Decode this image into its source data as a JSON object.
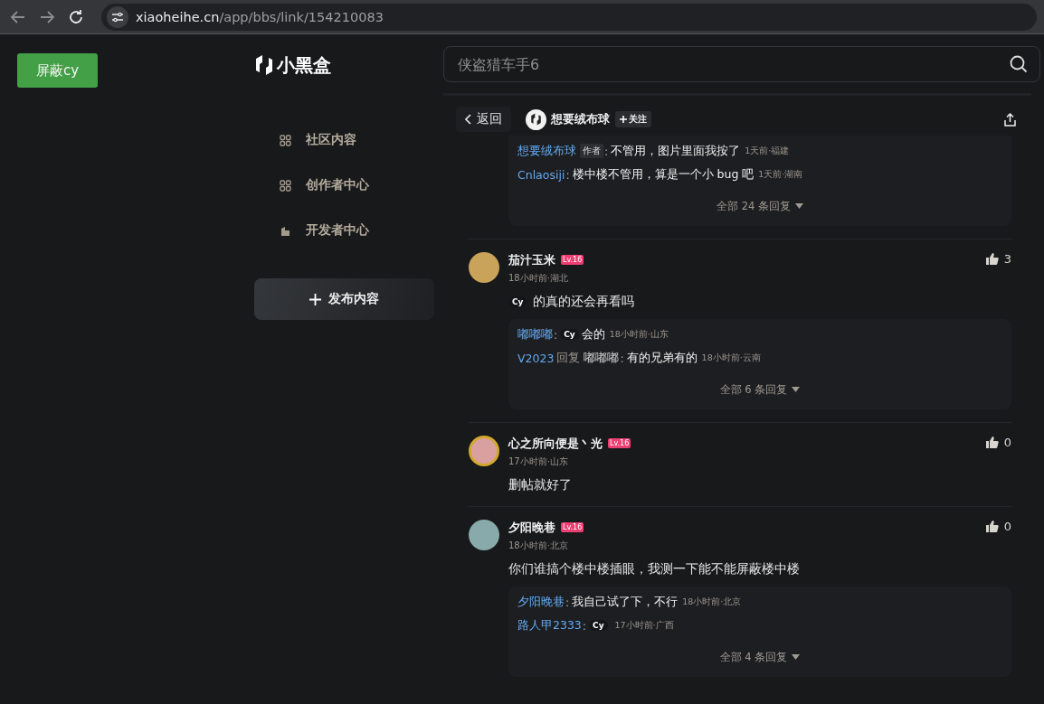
{
  "browser": {
    "url_host": "xiaoheihe.cn",
    "url_path": "/app/bbs/link/154210083"
  },
  "block_button": "屏蔽cy",
  "logo": "小黑盒",
  "nav": [
    {
      "label": "社区内容",
      "kind": "grid"
    },
    {
      "label": "创作者中心",
      "kind": "grid"
    },
    {
      "label": "开发者中心",
      "kind": "building"
    }
  ],
  "publish_button": "发布内容",
  "search": {
    "placeholder": "侠盗猎车手6"
  },
  "post_header": {
    "back": "返回",
    "author": "想要绒布球",
    "follow": "关注"
  },
  "comments": [
    {
      "replies": [
        {
          "user": "想要绒布球",
          "badge": "作者",
          "colon": ":",
          "text": "不管用，图片里面我按了",
          "meta": "1天前·福建"
        },
        {
          "user": "Cnlaosiji",
          "colon": ":",
          "text": "楼中楼不管用，算是一个小 bug 吧",
          "meta": "1天前·湖南"
        }
      ],
      "more": "全部 24 条回复"
    },
    {
      "name": "茄汁玉米",
      "level": "Lv.16",
      "avatar_frame": false,
      "time": "18小时前·湖北",
      "likes": "3",
      "tag": "Cy",
      "body": "的真的还会再看吗",
      "replies": [
        {
          "user": "嘟嘟嘟",
          "colon": ":",
          "tag": "Cy",
          "text": "会的",
          "meta": "18小时前·山东"
        },
        {
          "user": "V2023",
          "reply_label": "回复",
          "reply_to": "嘟嘟嘟",
          "colon": ":",
          "text": "有的兄弟有的",
          "meta": "18小时前·云南"
        }
      ],
      "more": "全部 6 条回复"
    },
    {
      "name": "心之所向便是丶光",
      "level": "Lv.16",
      "avatar_frame": true,
      "time": "17小时前·山东",
      "likes": "0",
      "body": "删帖就好了"
    },
    {
      "name": "夕阳晚巷",
      "level": "Lv.16",
      "avatar_frame": false,
      "time": "18小时前·北京",
      "likes": "0",
      "body": "你们谁搞个楼中楼插眼，我测一下能不能屏蔽楼中楼",
      "replies": [
        {
          "user": "夕阳晚巷",
          "colon": ":",
          "text": "我自己试了下，不行",
          "meta": "18小时前·北京"
        },
        {
          "user": "路人甲2333",
          "colon": ":",
          "tag": "Cy",
          "meta": "17小时前·广西"
        }
      ],
      "more": "全部 4 条回复"
    }
  ]
}
